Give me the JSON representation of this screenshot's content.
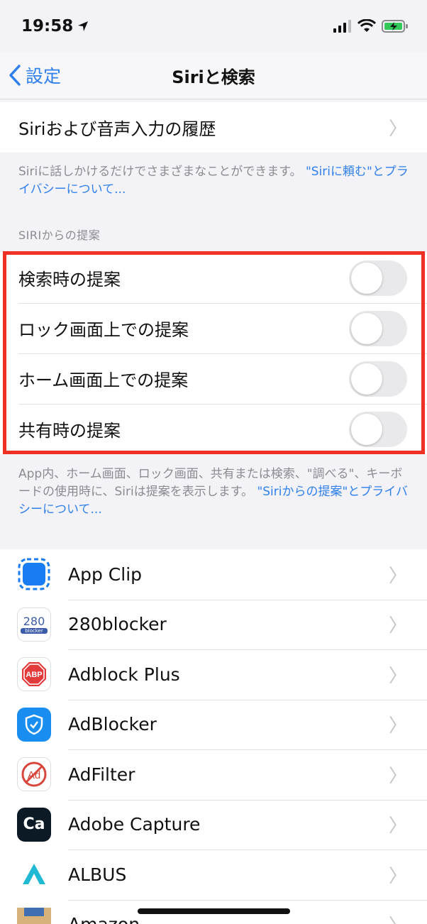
{
  "status_bar": {
    "time": "19:58"
  },
  "nav": {
    "back_label": "設定",
    "title": "Siriと検索"
  },
  "history_cell": {
    "label": "Siriおよび音声入力の履歴"
  },
  "siri_footnote": {
    "text": "Siriに話しかけるだけでさまざまなことができます。",
    "link": "\"Siriに頼む\"とプライバシーについて..."
  },
  "suggestions_section": {
    "header": "SIRIからの提案",
    "items": [
      {
        "label": "検索時の提案",
        "enabled": false
      },
      {
        "label": "ロック画面上での提案",
        "enabled": false
      },
      {
        "label": "ホーム画面上での提案",
        "enabled": false
      },
      {
        "label": "共有時の提案",
        "enabled": false
      }
    ]
  },
  "suggestions_footnote": {
    "text": "App内、ホーム画面、ロック画面、共有または検索、\"調べる\"、キーボードの使用時に、Siriは提案を表示します。",
    "link": "\"Siriからの提案\"とプライバシーについて..."
  },
  "apps": [
    {
      "name": "App Clip",
      "icon": "app-clip-icon"
    },
    {
      "name": "280blocker",
      "icon": "280blocker-icon",
      "icon_text": "280",
      "icon_subtext": "blocker"
    },
    {
      "name": "Adblock Plus",
      "icon": "adblock-plus-icon",
      "icon_text": "ABP"
    },
    {
      "name": "AdBlocker",
      "icon": "adblocker-icon"
    },
    {
      "name": "AdFilter",
      "icon": "adfilter-icon",
      "icon_text": "Ad"
    },
    {
      "name": "Adobe Capture",
      "icon": "adobe-capture-icon",
      "icon_text": "Ca"
    },
    {
      "name": "ALBUS",
      "icon": "albus-icon"
    },
    {
      "name": "Amazon",
      "icon": "amazon-icon"
    }
  ],
  "colors": {
    "accent": "#2f80ed",
    "highlight": "#ee3124",
    "toggle_off": "#e9e9eb"
  }
}
